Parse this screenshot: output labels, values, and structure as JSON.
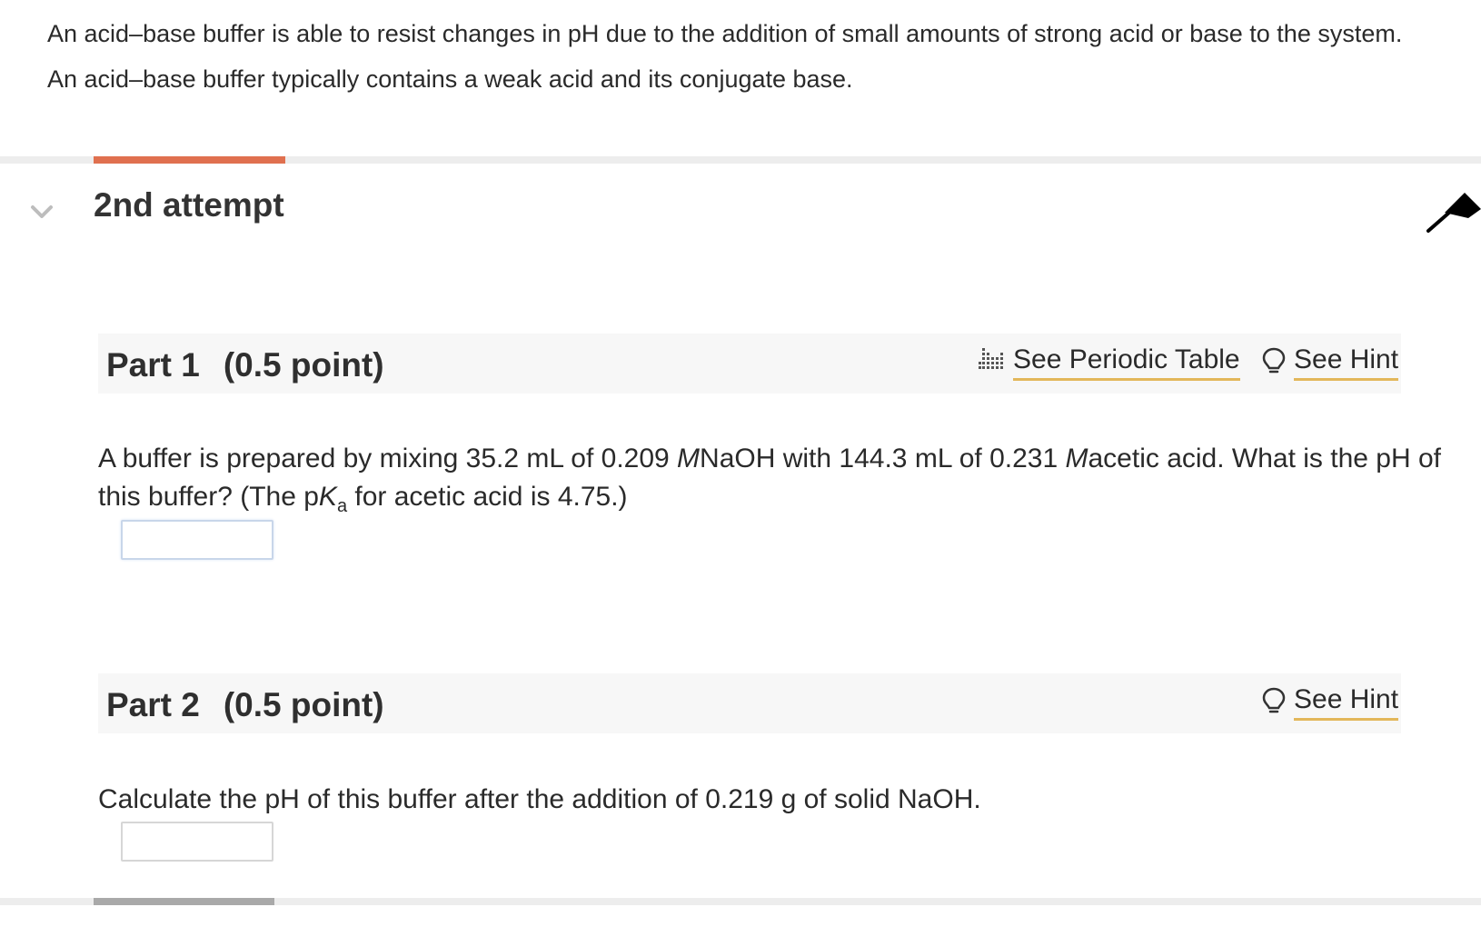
{
  "intro": {
    "line1": "An acid–base buffer is able to resist changes in pH due to the addition of small amounts of strong acid or base to the system.",
    "line2": "An acid–base buffer typically contains a weak acid and its conjugate base."
  },
  "attempt": {
    "title": "2nd attempt"
  },
  "part1": {
    "label": "Part 1",
    "points": "(0.5 point)",
    "periodic_link": "See Periodic Table",
    "hint_link": "See Hint",
    "q_a": "A buffer is prepared by mixing 35.2 mL of 0.209  ",
    "q_m1": "M",
    "q_b": "NaOH with 144.3  mL of 0.231 ",
    "q_m2": "M",
    "q_c": "acetic acid. What is the pH of this buffer? (The p",
    "q_k": "K",
    "q_sub": "a",
    "q_d": " for acetic acid is 4.75.)",
    "answer_value": ""
  },
  "part2": {
    "label": "Part 2",
    "points": "(0.5 point)",
    "hint_link": "See Hint",
    "question": "Calculate the pH of this buffer after the addition of 0.219  g of solid NaOH.",
    "answer_value": ""
  },
  "colors": {
    "progress_accent": "#e0704f",
    "link_underline": "#e3b75a",
    "progress_grey": "#a9a9a9"
  },
  "icons": {
    "collapse": "chevron-down-icon",
    "pin": "pin-icon",
    "periodic": "periodic-table-icon",
    "hint": "lightbulb-icon"
  }
}
